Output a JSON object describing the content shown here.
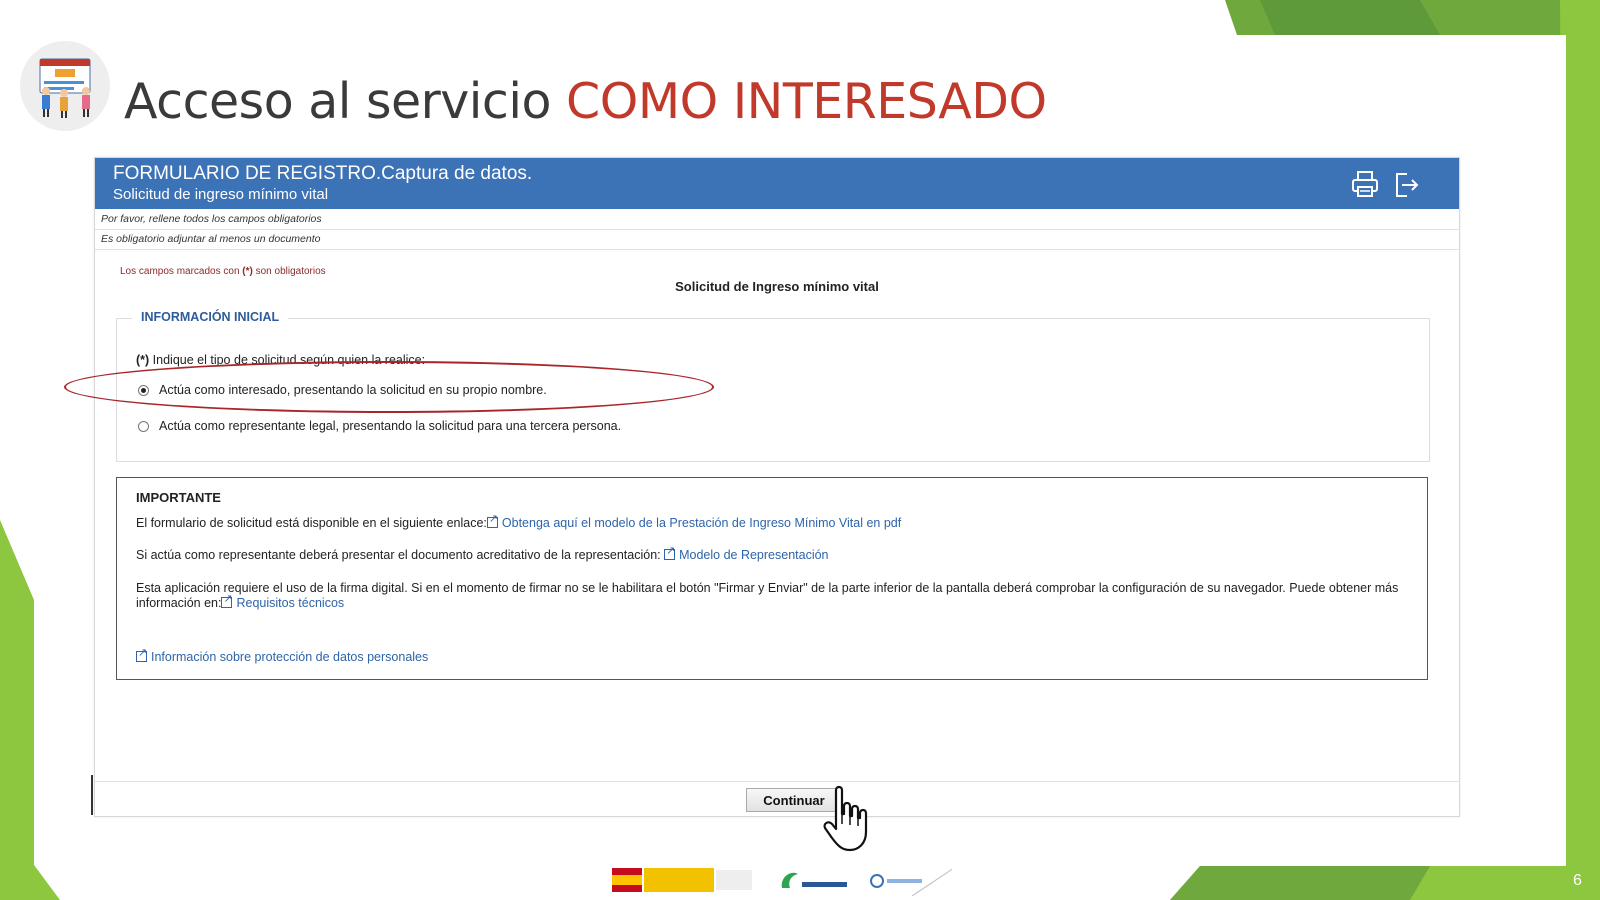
{
  "slide": {
    "title_prefix": "Acceso al servicio ",
    "title_accent": "COMO INTERESADO",
    "page_number": "6"
  },
  "colors": {
    "accent_green": "#8dc63f",
    "header_blue": "#3c72b6",
    "title_red": "#c0392b",
    "link_blue": "#2e64a8"
  },
  "app": {
    "header_title": "FORMULARIO DE REGISTRO.Captura de datos.",
    "header_subtitle": "Solicitud de ingreso mínimo vital",
    "header_icons": [
      "print-icon",
      "exit-icon"
    ],
    "notes": [
      "Por favor, rellene todos los campos obligatorios",
      "Es obligatorio adjuntar al menos un documento"
    ],
    "required_prefix": "Los campos marcados con ",
    "required_mark": "(*)",
    "required_suffix": " son obligatorios",
    "form_title": "Solicitud de Ingreso mínimo vital",
    "section_legend": "INFORMACIÓN INICIAL",
    "question_mark": "(*)",
    "question": " Indique el tipo de solicitud según quien la realice:",
    "options": [
      {
        "label": "Actúa como interesado, presentando la solicitud en su propio nombre.",
        "selected": true
      },
      {
        "label": "Actúa como representante legal, presentando la solicitud para una tercera persona.",
        "selected": false
      }
    ],
    "important": {
      "title": "IMPORTANTE",
      "line1_text": "El formulario de solicitud está disponible en el siguiente enlace:",
      "line1_link": "Obtenga aquí el modelo de la Prestación de Ingreso Mínimo Vital en pdf",
      "line2_text": "Si actúa como representante deberá presentar el documento acreditativo de la representación: ",
      "line2_link": "Modelo de Representación",
      "line3_text": "Esta aplicación requiere el uso de la firma digital. Si en el momento de firmar no se le habilitara el botón \"Firmar y Enviar\" de la parte inferior de la pantalla deberá comprobar la configuración de su navegador. Puede obtener más información en:",
      "line3_link": "Requisitos técnicos",
      "privacy_link": "Información sobre protección de datos personales"
    },
    "continue_button": "Continuar"
  }
}
